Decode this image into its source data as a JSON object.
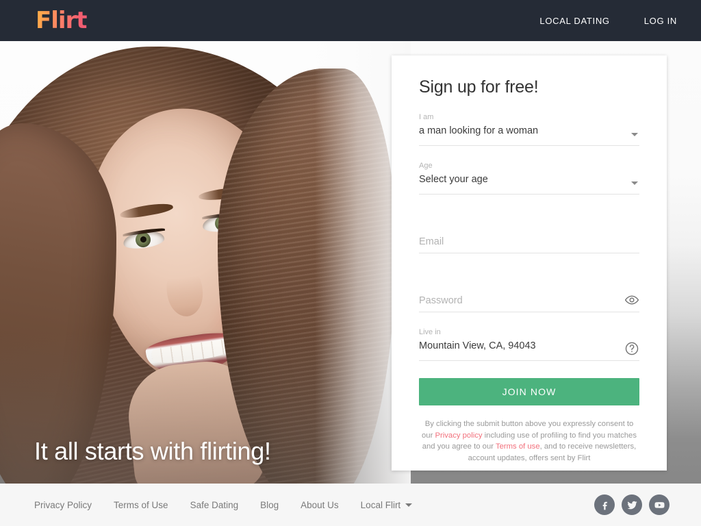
{
  "header": {
    "logo_text": "Flirt",
    "nav": [
      {
        "label": "LOCAL DATING",
        "name": "nav-local-dating"
      },
      {
        "label": "LOG IN",
        "name": "nav-log-in"
      }
    ]
  },
  "hero": {
    "tagline": "It all starts with flirting!",
    "image_alt": "Smiling woman with long brown hair"
  },
  "signup": {
    "title": "Sign up for free!",
    "i_am": {
      "label": "I am",
      "value": "a man looking for a woman"
    },
    "age": {
      "label": "Age",
      "value": "Select your age"
    },
    "email": {
      "label": "",
      "placeholder": "Email",
      "value": ""
    },
    "password": {
      "label": "",
      "placeholder": "Password",
      "value": ""
    },
    "live_in": {
      "label": "Live in",
      "value": "Mountain View, CA, 94043"
    },
    "submit_label": "JOIN NOW",
    "legal": {
      "part1": "By clicking the submit button above you expressly consent to our ",
      "link1": "Privacy policy",
      "part2": " including use of profiling to find you matches and you agree to our ",
      "link2": "Terms of use",
      "part3": ", and to receive newsletters, account updates, offers sent by Flirt"
    }
  },
  "footer": {
    "links": [
      {
        "label": "Privacy Policy",
        "name": "footer-link-privacy-policy"
      },
      {
        "label": "Terms of Use",
        "name": "footer-link-terms-of-use"
      },
      {
        "label": "Safe Dating",
        "name": "footer-link-safe-dating"
      },
      {
        "label": "Blog",
        "name": "footer-link-blog"
      },
      {
        "label": "About Us",
        "name": "footer-link-about-us"
      }
    ],
    "dropdown_label": "Local Flirt",
    "socials": [
      {
        "name": "facebook-icon",
        "label": "Facebook"
      },
      {
        "name": "twitter-icon",
        "label": "Twitter"
      },
      {
        "name": "youtube-icon",
        "label": "YouTube"
      }
    ]
  },
  "colors": {
    "header_bg": "#252b36",
    "accent_green": "#4cb37e",
    "link_pink": "#f2707c",
    "logo_gradient_start": "#ffb347",
    "logo_gradient_end": "#ef5a73",
    "footer_bg": "#f6f6f6",
    "social_circle": "#6c727c"
  }
}
